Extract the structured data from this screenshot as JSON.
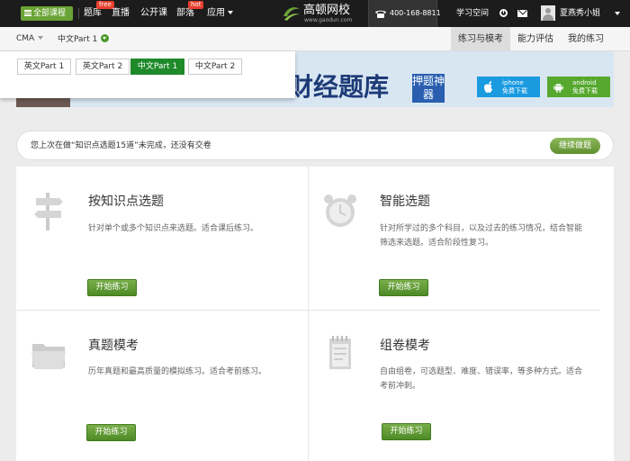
{
  "topbar": {
    "all_courses": "全部课程",
    "nav": [
      {
        "label": "题库",
        "badge": "free"
      },
      {
        "label": "直播",
        "badge": ""
      },
      {
        "label": "公开课",
        "badge": ""
      },
      {
        "label": "部落",
        "badge": "hot"
      },
      {
        "label": "应用",
        "badge": ""
      }
    ],
    "logo_name": "高顿网校",
    "logo_url": "www.gaodun.com",
    "phone": "400-168-8811",
    "study_space": "学习空间",
    "username": "夏燕秀小姐"
  },
  "subbar": {
    "exam": "CMA",
    "part": "中文Part 1",
    "tabs": [
      "练习与模考",
      "能力评估",
      "我的练习"
    ]
  },
  "dropdown": {
    "options": [
      "英文Part 1",
      "英文Part 2",
      "中文Part 1",
      "中文Part 2"
    ],
    "selected": "中文Part 1"
  },
  "banner": {
    "title": "财经题库",
    "slogan": "押题神器",
    "iphone_label": "iphone",
    "iphone_sub": "免费下载",
    "android_label": "android",
    "android_sub": "免费下载"
  },
  "notice": {
    "text": "您上次在做“知识点选题15道”未完成，还没有交卷",
    "button": "继续做题"
  },
  "cards": [
    {
      "title": "按知识点选题",
      "desc": "针对单个或多个知识点来选题。适合课后练习。",
      "button": "开始练习",
      "icon": "signpost-icon"
    },
    {
      "title": "智能选题",
      "desc": "针对所学过的多个科目，以及过去的练习情况，结合智能筛选来选题。适合阶段性复习。",
      "button": "开始练习",
      "icon": "alarm-clock-icon"
    },
    {
      "title": "真题模考",
      "desc": "历年真题和最高质量的模拟练习。适合考前练习。",
      "button": "开始练习",
      "icon": "folder-icon"
    },
    {
      "title": "组卷模考",
      "desc": "自由组卷，可选题型、难度、错误率，等多种方式。适合考前冲刺。",
      "button": "开始练习",
      "icon": "notepad-icon"
    }
  ]
}
